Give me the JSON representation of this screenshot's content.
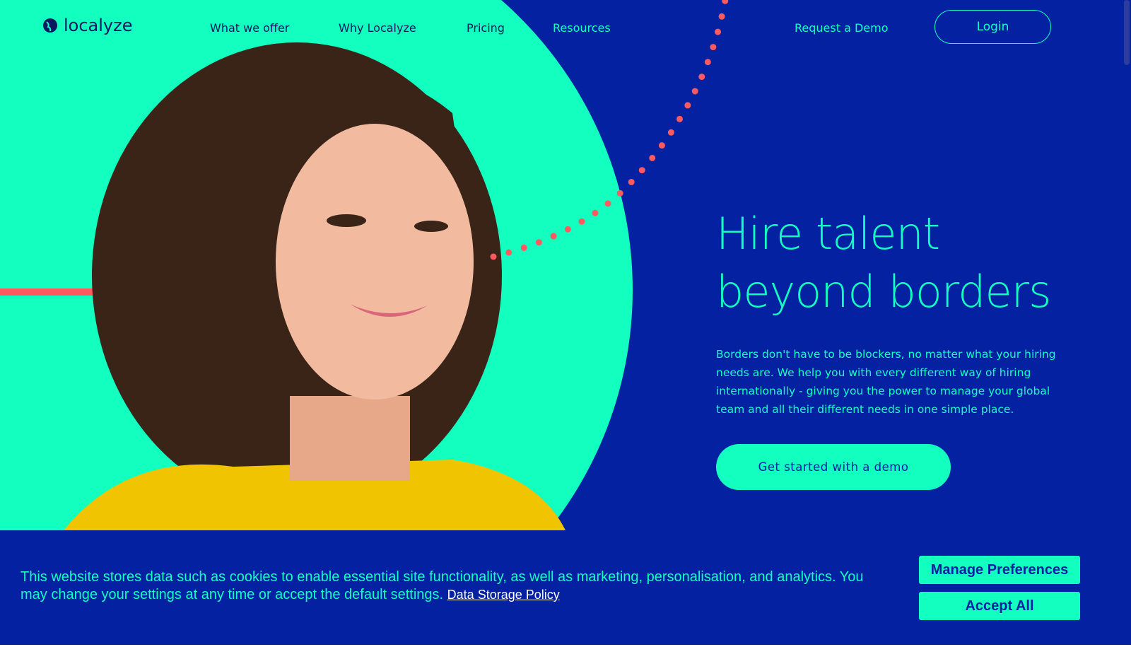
{
  "brand": {
    "name": "localyze"
  },
  "nav": {
    "items": [
      "What we offer",
      "Why Localyze",
      "Pricing",
      "Resources"
    ],
    "request_demo": "Request a Demo",
    "login": "Login"
  },
  "hero": {
    "title_line1": "Hire talent",
    "title_line2": "beyond borders",
    "description": "Borders don't have to be blockers, no matter what your hiring needs are. We help you with every different way of hiring internationally - giving you the power to manage your global team and all their different needs in one simple place.",
    "cta": "Get started with a demo"
  },
  "cookie": {
    "text": "This website stores data such as cookies to enable essential site functionality, as well as marketing, personalisation, and analytics. You may change your settings at any time or accept the default settings.",
    "policy_link": "Data Storage Policy",
    "manage": "Manage Preferences",
    "accept": "Accept All"
  },
  "colors": {
    "brand_blue": "#0321a1",
    "mint": "#12ffc0",
    "accent_red": "#ff5a5f"
  }
}
